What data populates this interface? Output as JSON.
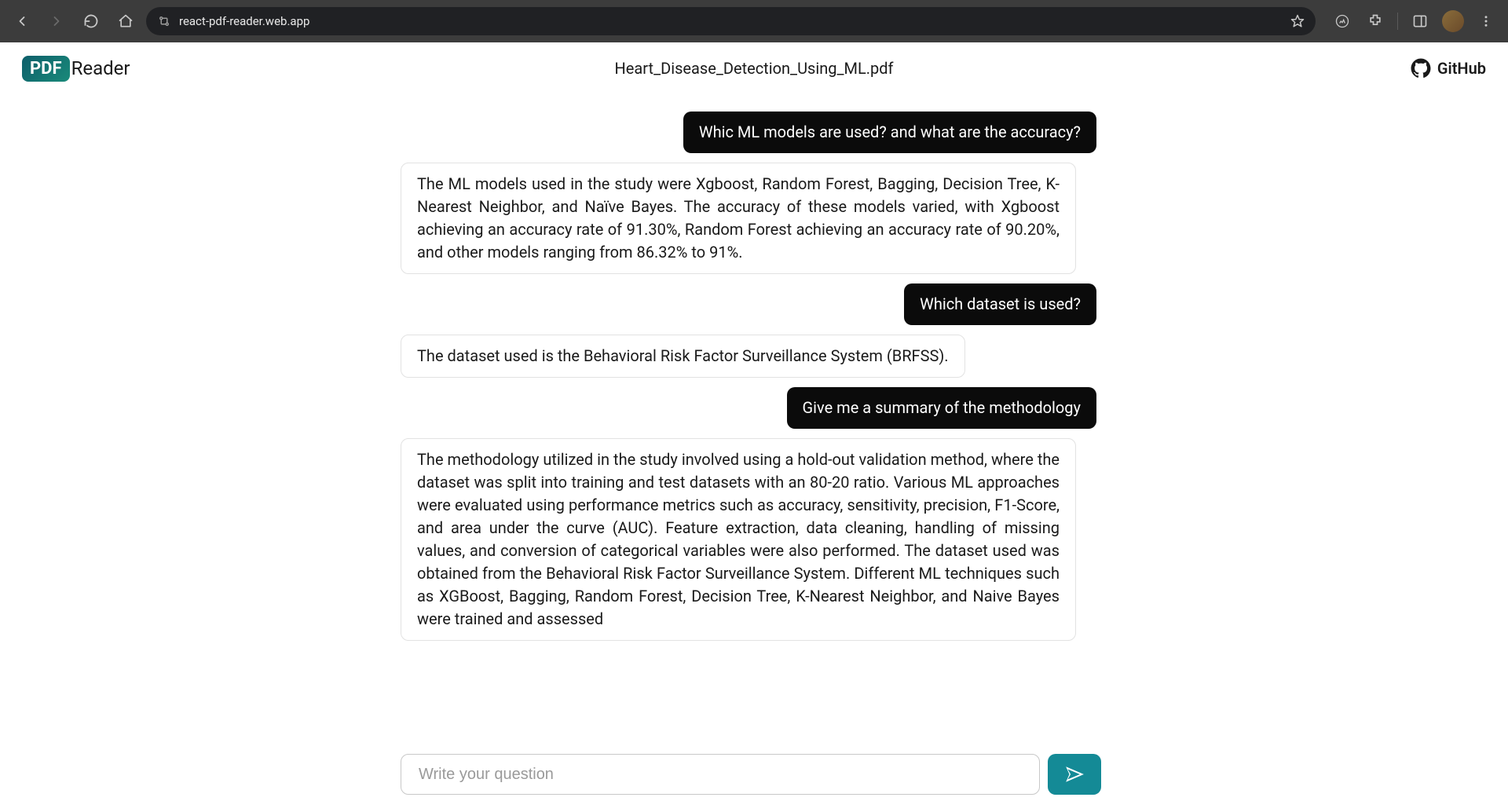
{
  "browser": {
    "url": "react-pdf-reader.web.app"
  },
  "app": {
    "logo_badge": "PDF",
    "logo_text": "Reader",
    "doc_title": "Heart_Disease_Detection_Using_ML.pdf",
    "github_label": "GitHub"
  },
  "chat": {
    "messages": [
      {
        "role": "user",
        "text": "Whic ML models are used? and what are the accuracy?"
      },
      {
        "role": "bot",
        "text": "The ML models used in the study were Xgboost, Random Forest, Bagging, Decision Tree, K-Nearest Neighbor, and Naïve Bayes. The accuracy of these models varied, with Xgboost achieving an accuracy rate of 91.30%, Random Forest achieving an accuracy rate of 90.20%, and other models ranging from 86.32% to 91%."
      },
      {
        "role": "user",
        "text": "Which dataset is used?"
      },
      {
        "role": "bot",
        "text": "The dataset used is the Behavioral Risk Factor Surveillance System (BRFSS)."
      },
      {
        "role": "user",
        "text": "Give me a summary of the methodology"
      },
      {
        "role": "bot",
        "text": "The methodology utilized in the study involved using a hold-out validation method, where the dataset was split into training and test datasets with an 80-20 ratio. Various ML approaches were evaluated using performance metrics such as accuracy, sensitivity, precision, F1-Score, and area under the curve (AUC). Feature extraction, data cleaning, handling of missing values, and conversion of categorical variables were also performed. The dataset used was obtained from the Behavioral Risk Factor Surveillance System. Different ML techniques such as XGBoost, Bagging, Random Forest, Decision Tree, K-Nearest Neighbor, and Naive Bayes were trained and assessed"
      }
    ],
    "input_placeholder": "Write your question"
  }
}
